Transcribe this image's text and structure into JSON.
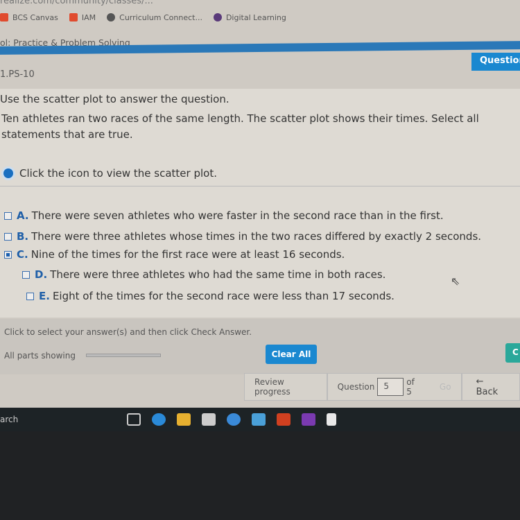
{
  "browser": {
    "url": "realize.com/community/classes/...",
    "bookmarks": [
      {
        "label": "BCS Canvas",
        "icon": "canvas-icon",
        "color": "#e04b2e"
      },
      {
        "label": "IAM",
        "icon": "iam-icon",
        "color": "#e04b2e"
      },
      {
        "label": "Curriculum Connect...",
        "icon": "globe-icon",
        "color": "#555"
      },
      {
        "label": "Digital Learning",
        "icon": "digital-learning-icon",
        "color": "#5a3a7a"
      }
    ]
  },
  "header": {
    "breadcrumb": "ol: Practice & Problem Solving",
    "question_button": "Question",
    "question_id": "1.PS-10"
  },
  "question": {
    "instruction": "Use the scatter plot to answer the question.",
    "prompt": "Ten athletes ran two races of the same length. The scatter plot shows their times. Select all statements that are true.",
    "plot_link": "Click the icon to view the scatter plot.",
    "options": [
      {
        "letter": "A.",
        "text": "There were seven athletes who were faster in the second race than in the first.",
        "checked": false
      },
      {
        "letter": "B.",
        "text": "There were three athletes whose times in the two races differed by exactly 2 seconds.",
        "checked": false
      },
      {
        "letter": "C.",
        "text": "Nine of the times for the first race were at least 16 seconds.",
        "checked": true
      },
      {
        "letter": "D.",
        "text": "There were three athletes who had the same time in both races.",
        "checked": false
      },
      {
        "letter": "E.",
        "text": "Eight of the times for the second race were less than 17 seconds.",
        "checked": false
      }
    ]
  },
  "footer": {
    "hint": "Click to select your answer(s) and then click Check Answer.",
    "parts": "All parts showing",
    "clear_all": "Clear All",
    "check": "C"
  },
  "nav": {
    "review": "Review progress",
    "question_label": "Question",
    "question_value": "5",
    "of": "of 5",
    "go": "Go",
    "back": "← Back"
  },
  "taskbar": {
    "search": "arch"
  }
}
